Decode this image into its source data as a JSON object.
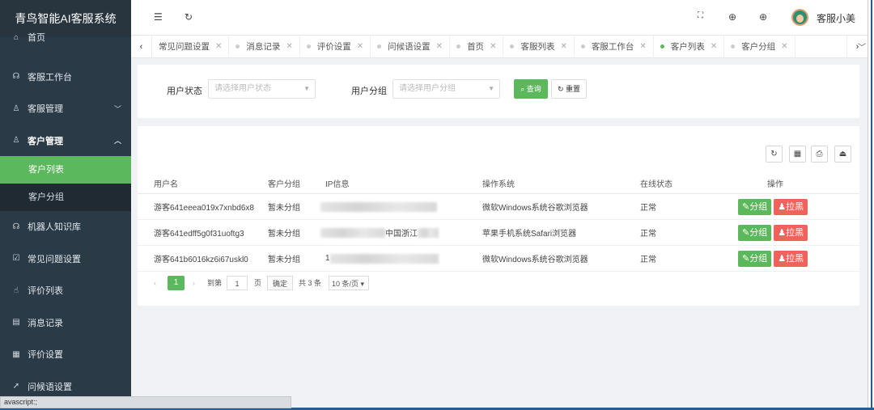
{
  "app": {
    "title": "青鸟智能AI客服系统"
  },
  "sidebar": {
    "items": [
      {
        "label": "首页",
        "icon": "home-icon",
        "glyph": "⌂"
      },
      {
        "label": "客服工作台",
        "icon": "support-icon",
        "glyph": "☊"
      },
      {
        "label": "客服管理",
        "icon": "user-icon",
        "glyph": "♙"
      },
      {
        "label": "客户管理",
        "icon": "users-icon",
        "glyph": "♙"
      },
      {
        "label": "机器人知识库",
        "icon": "robot-icon",
        "glyph": "☊"
      },
      {
        "label": "常见问题设置",
        "icon": "faq-icon",
        "glyph": "☑"
      },
      {
        "label": "评价列表",
        "icon": "thumb-icon",
        "glyph": "☝"
      },
      {
        "label": "消息记录",
        "icon": "message-icon",
        "glyph": "▤"
      },
      {
        "label": "评价设置",
        "icon": "settings-icon",
        "glyph": "▦"
      },
      {
        "label": "问候语设置",
        "icon": "send-icon",
        "glyph": "➚"
      }
    ],
    "sub_items": [
      {
        "label": "客户列表"
      },
      {
        "label": "客户分组"
      }
    ]
  },
  "header": {
    "user_name": "客服小美"
  },
  "tabs": [
    {
      "label": "常见问题设置"
    },
    {
      "label": "消息记录"
    },
    {
      "label": "评价设置"
    },
    {
      "label": "问候语设置"
    },
    {
      "label": "首页"
    },
    {
      "label": "客服列表"
    },
    {
      "label": "客服工作台"
    },
    {
      "label": "客户列表"
    },
    {
      "label": "客户分组"
    }
  ],
  "search": {
    "status_label": "用户状态",
    "status_placeholder": "请选择用户状态",
    "group_label": "用户分组",
    "group_placeholder": "请选择用户分组",
    "query_label": "查询",
    "reset_label": "重置"
  },
  "table": {
    "headers": [
      "用户名",
      "客户分组",
      "IP信息",
      "操作系统",
      "在线状态",
      "操作"
    ],
    "rows": [
      {
        "user": "游客641eeea019x7xnbd6x8",
        "group": "暂未分组",
        "ip_text": "",
        "os": "微软Windows系统谷歌浏览器",
        "status": "正常"
      },
      {
        "user": "游客641edff5g0f31uoftg3",
        "group": "暂未分组",
        "ip_text": "中国浙江",
        "os": "苹果手机系统Safari浏览器",
        "status": "正常"
      },
      {
        "user": "游客641b6016kz6i67uskl0",
        "group": "暂未分组",
        "ip_text": "1",
        "os": "微软Windows系统谷歌浏览器",
        "status": "正常"
      }
    ],
    "action_group": "分组",
    "action_block": "拉黑"
  },
  "pager": {
    "current": "1",
    "goto_label": "到第",
    "page_input": "1",
    "page_unit": "页",
    "confirm": "确定",
    "total": "共 3 条",
    "page_size": "10 条/页"
  },
  "statusbar": {
    "text": "avascript:;"
  },
  "colors": {
    "sidebar": "#2b3a47",
    "accent": "#5cb85c",
    "danger": "#f0625c"
  }
}
